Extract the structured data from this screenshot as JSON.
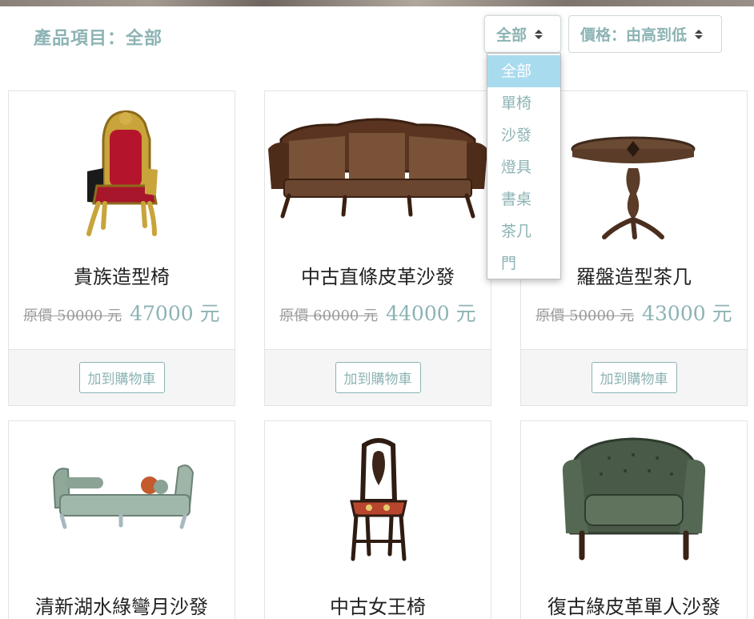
{
  "header": {
    "category_title": "產品項目：全部",
    "category_select": "全部",
    "price_select": "價格：由高到低"
  },
  "dropdown": {
    "options": [
      "全部",
      "單椅",
      "沙發",
      "燈具",
      "書桌",
      "茶几",
      "門"
    ],
    "selected": "全部"
  },
  "products": [
    {
      "name": "貴族造型椅",
      "original_price": "原價 50000 元",
      "price": "47000 元",
      "button": "加到購物車",
      "icon": "throne-chair-image"
    },
    {
      "name": "中古直條皮革沙發",
      "original_price": "原價 60000 元",
      "price": "44000 元",
      "button": "加到購物車",
      "icon": "leather-sofa-image"
    },
    {
      "name": "羅盤造型茶几",
      "original_price": "原價 50000 元",
      "price": "43000 元",
      "button": "加到購物車",
      "icon": "compass-table-image"
    },
    {
      "name": "清新湖水綠彎月沙發",
      "icon": "chaise-sofa-image"
    },
    {
      "name": "中古女王椅",
      "icon": "queen-chair-image"
    },
    {
      "name": "復古綠皮革單人沙發",
      "icon": "green-armchair-image"
    }
  ],
  "colors": {
    "accent": "#8db3b4",
    "dropdown_active": "#a9dbef",
    "footer_bg": "#f5f5f5"
  }
}
